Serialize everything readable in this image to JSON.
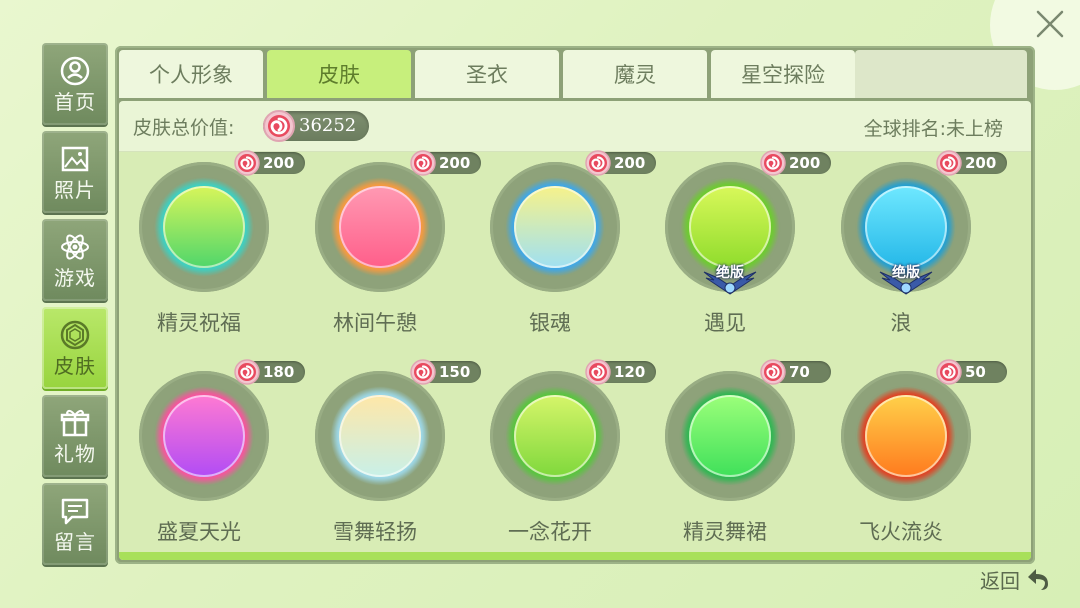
{
  "sidebar": {
    "items": [
      {
        "label": "首页",
        "icon": "user-circle-icon",
        "active": false
      },
      {
        "label": "照片",
        "icon": "photo-icon",
        "active": false
      },
      {
        "label": "游戏",
        "icon": "atom-icon",
        "active": false
      },
      {
        "label": "皮肤",
        "icon": "gem-icon",
        "active": true
      },
      {
        "label": "礼物",
        "icon": "gift-icon",
        "active": false
      },
      {
        "label": "留言",
        "icon": "message-icon",
        "active": false
      }
    ]
  },
  "tabs": [
    {
      "label": "个人形象",
      "active": false
    },
    {
      "label": "皮肤",
      "active": true
    },
    {
      "label": "圣衣",
      "active": false
    },
    {
      "label": "魔灵",
      "active": false
    },
    {
      "label": "星空探险",
      "active": false
    }
  ],
  "summary": {
    "label": "皮肤总价值:",
    "value": "36252",
    "rank": "全球排名:未上榜"
  },
  "skins": [
    {
      "name": "精灵祝福",
      "price": "200",
      "badge": "",
      "colors": [
        "#d8f55a",
        "#4fd66b",
        "#38d4c8"
      ]
    },
    {
      "name": "林间午憩",
      "price": "200",
      "badge": "",
      "colors": [
        "#ff9ab3",
        "#ff5e8a",
        "#ff9a3c"
      ]
    },
    {
      "name": "银魂",
      "price": "200",
      "badge": "",
      "colors": [
        "#f7f28a",
        "#9fe0f2",
        "#3aa8f0"
      ]
    },
    {
      "name": "遇见",
      "price": "200",
      "badge": "绝版",
      "colors": [
        "#d9f85a",
        "#8fdc2c",
        "#6bcf2a"
      ]
    },
    {
      "name": "浪",
      "price": "200",
      "badge": "绝版",
      "colors": [
        "#6fe8ff",
        "#25b8e8",
        "#1c9fd8"
      ]
    },
    {
      "name": "盛夏天光",
      "price": "180",
      "badge": "",
      "colors": [
        "#ff7ad2",
        "#b14cf5",
        "#ff4fa0"
      ]
    },
    {
      "name": "雪舞轻扬",
      "price": "150",
      "badge": "",
      "colors": [
        "#ffe7a8",
        "#c8f0e8",
        "#9fdcf0"
      ]
    },
    {
      "name": "一念花开",
      "price": "120",
      "badge": "",
      "colors": [
        "#d6f56a",
        "#7fd83c",
        "#55c83a"
      ]
    },
    {
      "name": "精灵舞裙",
      "price": "70",
      "badge": "",
      "colors": [
        "#9cff7a",
        "#3fe05a",
        "#2ab850"
      ]
    },
    {
      "name": "飞火流炎",
      "price": "50",
      "badge": "",
      "colors": [
        "#ffd14a",
        "#ff7a1e",
        "#e63c1e"
      ]
    }
  ],
  "footer": {
    "back_label": "返回"
  },
  "colors": {
    "accent": "#c7ef7c",
    "coin": "#e84a5f"
  }
}
